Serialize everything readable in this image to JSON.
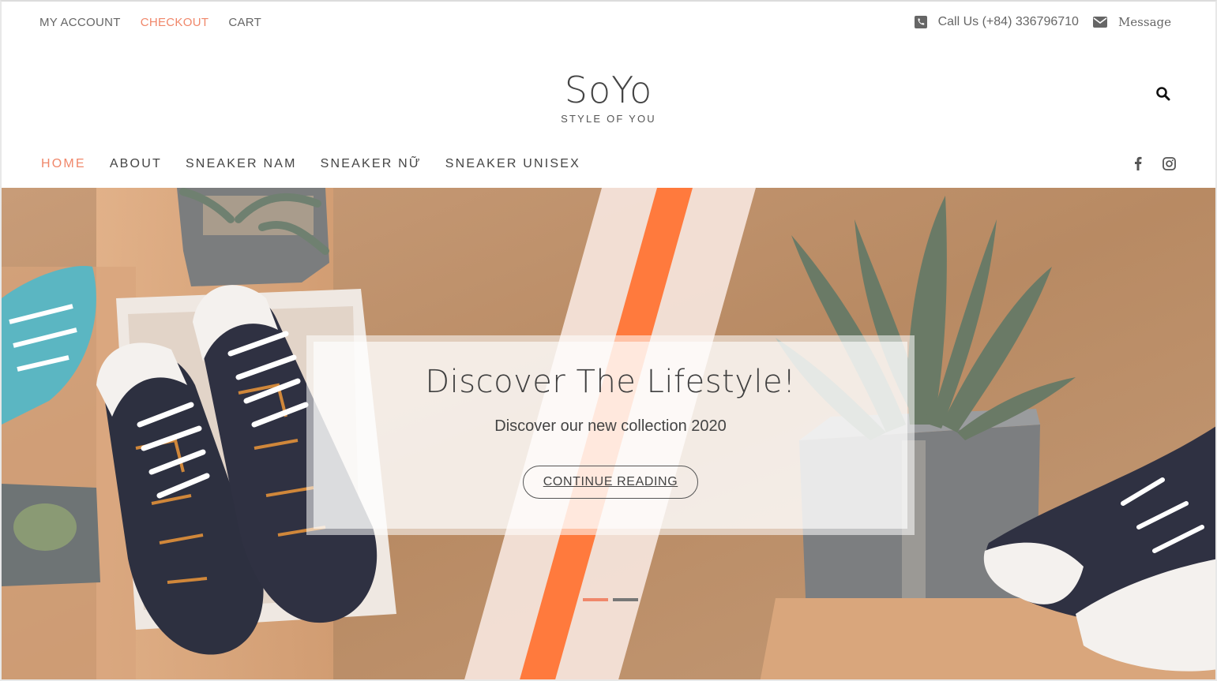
{
  "top_links": [
    {
      "label": "MY ACCOUNT",
      "active": false
    },
    {
      "label": "CHECKOUT",
      "active": true
    },
    {
      "label": "CART",
      "active": false
    }
  ],
  "contact": {
    "phone_label": "Call Us (+84) 336796710",
    "message_label": "Message"
  },
  "logo": {
    "title": "SoYo",
    "tagline": "STYLE OF YOU"
  },
  "main_nav": [
    {
      "label": "HOME",
      "active": true
    },
    {
      "label": "ABOUT",
      "active": false
    },
    {
      "label": "SNEAKER NAM",
      "active": false
    },
    {
      "label": "SNEAKER NỮ",
      "active": false
    },
    {
      "label": "SNEAKER UNISEX",
      "active": false
    }
  ],
  "social": [
    "facebook-icon",
    "instagram-icon"
  ],
  "hero": {
    "title": "Discover The Lifestyle!",
    "subtitle": "Discover our new collection 2020",
    "button_label": "CONTINUE READING",
    "slides_total": 2,
    "active_slide": 1
  },
  "colors": {
    "accent": "#f0876a",
    "text": "#444444"
  }
}
